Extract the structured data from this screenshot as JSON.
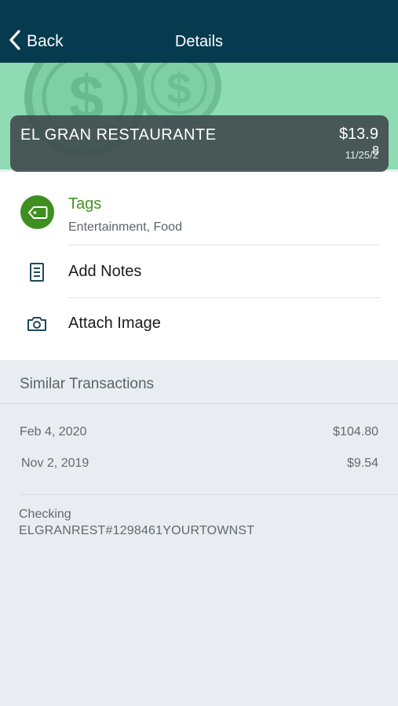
{
  "nav": {
    "back_label": "Back",
    "title": "Details",
    "background": "#063b4f"
  },
  "transaction": {
    "merchant": "EL GRAN RESTAURANTE",
    "amount": "$13.9",
    "amount_overflow": "8",
    "date": "11/25/2"
  },
  "actions": {
    "tags_label": "Tags",
    "tags_value": "Entertainment, Food",
    "notes_label": "Add Notes",
    "image_label": "Attach Image"
  },
  "similar": {
    "title": "Similar Transactions",
    "items": [
      {
        "date": "Feb 4, 2020",
        "amount": "$104.80"
      },
      {
        "date": "Nov 2, 2019",
        "amount": "$9.54"
      }
    ]
  },
  "details": {
    "account": "Checking",
    "descriptor": "ELGRANREST#1298461YOURTOWNST"
  },
  "colors": {
    "hero": "#8fdbb3",
    "accent_green": "#43931f",
    "tag_circle": "#3e8f1f"
  },
  "icons": [
    "chevron-left-icon",
    "dollar-coin-icon",
    "tag-icon",
    "notes-icon",
    "camera-icon"
  ]
}
